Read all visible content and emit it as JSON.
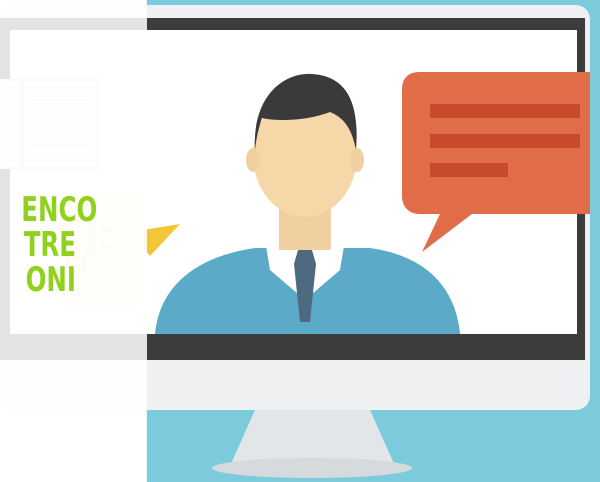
{
  "banner": {
    "title_lines": [
      "ENCO",
      "TRE",
      "ONI"
    ]
  },
  "colors": {
    "background_blue": "#7ccbdc",
    "monitor_bezel": "#3c3c3c",
    "monitor_body": "#eef0f1",
    "shirt": "#5aaac8",
    "speech_bubble": "#e06c48",
    "title_green": "#8fd11d"
  },
  "icons": [
    "open-book-icon",
    "lightbulb-icon",
    "person-icon",
    "speech-bubble-icon"
  ]
}
